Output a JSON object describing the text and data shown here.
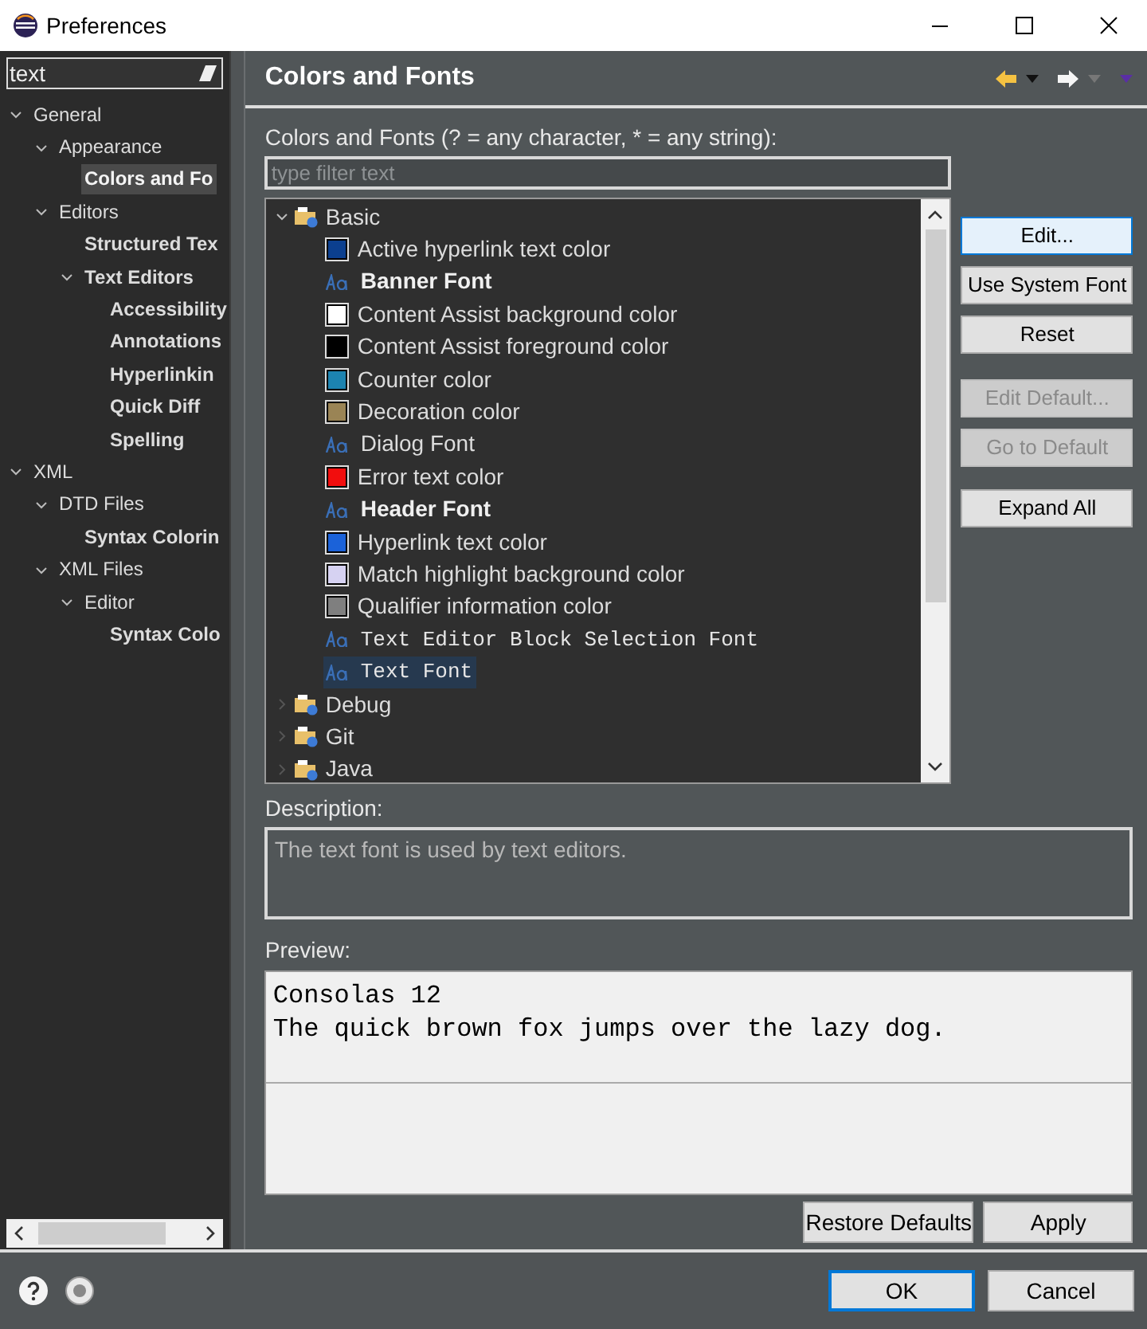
{
  "window": {
    "title": "Preferences"
  },
  "sidebar": {
    "filter": {
      "value": "text"
    },
    "tree": [
      {
        "label": "General",
        "match": false,
        "selected": false,
        "expanded": true,
        "children": [
          {
            "label": "Appearance",
            "match": false,
            "selected": false,
            "expanded": true,
            "children": [
              {
                "label": "Colors and Fo",
                "match": true,
                "selected": true
              }
            ]
          },
          {
            "label": "Editors",
            "match": false,
            "selected": false,
            "expanded": true,
            "children": [
              {
                "label": "Structured Tex",
                "match": true,
                "selected": false
              },
              {
                "label": "Text Editors",
                "match": true,
                "selected": false,
                "expanded": true,
                "children": [
                  {
                    "label": "Accessibility",
                    "match": true,
                    "selected": false
                  },
                  {
                    "label": "Annotations",
                    "match": true,
                    "selected": false
                  },
                  {
                    "label": "Hyperlinkin",
                    "match": true,
                    "selected": false
                  },
                  {
                    "label": "Quick Diff",
                    "match": true,
                    "selected": false
                  },
                  {
                    "label": "Spelling",
                    "match": true,
                    "selected": false
                  }
                ]
              }
            ]
          }
        ]
      },
      {
        "label": "XML",
        "match": false,
        "selected": false,
        "expanded": true,
        "children": [
          {
            "label": "DTD Files",
            "match": false,
            "selected": false,
            "expanded": true,
            "children": [
              {
                "label": "Syntax Colorin",
                "match": true,
                "selected": false
              }
            ]
          },
          {
            "label": "XML Files",
            "match": false,
            "selected": false,
            "expanded": true,
            "children": [
              {
                "label": "Editor",
                "match": false,
                "selected": false,
                "expanded": true,
                "children": [
                  {
                    "label": "Syntax Colo",
                    "match": true,
                    "selected": false
                  }
                ]
              }
            ]
          }
        ]
      }
    ]
  },
  "page": {
    "title": "Colors and Fonts",
    "filter_label": "Colors and Fonts (? = any character, * = any string):",
    "filter": {
      "placeholder": "type filter text"
    },
    "tree": [
      {
        "kind": "category",
        "label": "Basic",
        "expanded": true,
        "children": [
          {
            "kind": "color",
            "label": "Active hyperlink text color",
            "color": "#0b3f8f",
            "selected": false
          },
          {
            "kind": "bold_font",
            "label": "Banner Font",
            "selected": false
          },
          {
            "kind": "color",
            "label": "Content Assist background color",
            "color": "#ffffff",
            "selected": false
          },
          {
            "kind": "color",
            "label": "Content Assist foreground color",
            "color": "#000000",
            "selected": false
          },
          {
            "kind": "color",
            "label": "Counter color",
            "color": "#1c83b0",
            "selected": false
          },
          {
            "kind": "color",
            "label": "Decoration color",
            "color": "#9a8455",
            "selected": false
          },
          {
            "kind": "font",
            "label": "Dialog Font",
            "selected": false
          },
          {
            "kind": "color",
            "label": "Error text color",
            "color": "#f20d0d",
            "selected": false
          },
          {
            "kind": "bold_font",
            "label": "Header Font",
            "selected": false
          },
          {
            "kind": "color",
            "label": "Hyperlink text color",
            "color": "#1b62d9",
            "selected": false
          },
          {
            "kind": "color",
            "label": "Match highlight background color",
            "color": "#d6d2f2",
            "selected": false
          },
          {
            "kind": "color",
            "label": "Qualifier information color",
            "color": "#7f7f7f",
            "selected": false
          },
          {
            "kind": "mono_font",
            "label": "Text Editor Block Selection Font",
            "selected": false
          },
          {
            "kind": "mono_font",
            "label": "Text Font",
            "selected": true
          }
        ]
      },
      {
        "kind": "category",
        "label": "Debug",
        "expanded": false
      },
      {
        "kind": "category",
        "label": "Git",
        "expanded": false
      },
      {
        "kind": "category",
        "label": "Java",
        "expanded": false
      }
    ],
    "buttons": [
      {
        "label": "Edit...",
        "disabled": false,
        "focused": true
      },
      {
        "label": "Use System Font",
        "disabled": false,
        "focused": false
      },
      {
        "label": "Reset",
        "disabled": false,
        "focused": false
      },
      {
        "label": "Edit Default...",
        "disabled": true,
        "focused": false
      },
      {
        "label": "Go to Default",
        "disabled": true,
        "focused": false
      },
      {
        "label": "Expand All",
        "disabled": false,
        "focused": false
      }
    ],
    "description_label": "Description:",
    "description": "The text font is used by text editors.",
    "preview_label": "Preview:",
    "preview_lines": [
      "Consolas 12",
      "The quick brown fox jumps over the lazy dog."
    ],
    "footer_buttons": [
      "Restore Defaults",
      "Apply"
    ]
  },
  "dialog_buttons": [
    {
      "label": "OK",
      "default": true
    },
    {
      "label": "Cancel",
      "default": false
    }
  ]
}
